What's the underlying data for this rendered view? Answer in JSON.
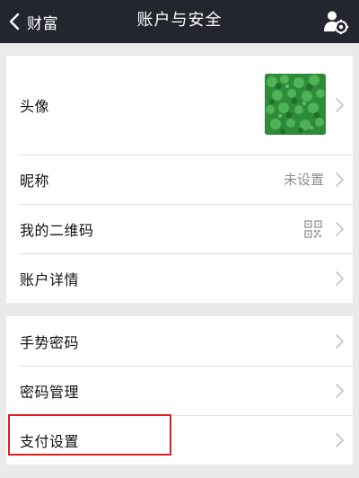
{
  "navbar": {
    "back_label": "财富",
    "title": "账户与安全",
    "action_icon": "user-settings-icon"
  },
  "group1": {
    "avatar_row": {
      "label": "头像"
    },
    "nickname_row": {
      "label": "昵称",
      "value": "未设置"
    },
    "qrcode_row": {
      "label": "我的二维码"
    },
    "account_detail_row": {
      "label": "账户详情"
    }
  },
  "group2": {
    "gesture_row": {
      "label": "手势密码"
    },
    "password_row": {
      "label": "密码管理"
    },
    "payment_row": {
      "label": "支付设置"
    }
  },
  "colors": {
    "navbar_bg": "#24262f",
    "highlight": "#e21d22",
    "background": "#eaeaea"
  }
}
